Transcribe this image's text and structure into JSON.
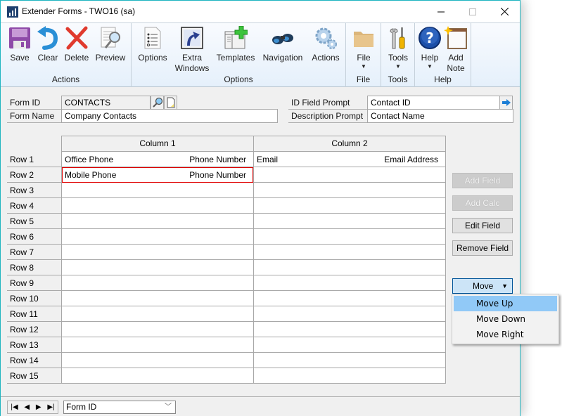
{
  "window": {
    "title": "Extender Forms  -  TWO16 (sa)",
    "controls": {
      "minimize": "—",
      "maximize": "☐",
      "close": "✕"
    }
  },
  "ribbon": {
    "groups": [
      {
        "label": "Actions",
        "buttons": [
          {
            "label": "Save",
            "icon": "save-icon"
          },
          {
            "label": "Clear",
            "icon": "undo-icon"
          },
          {
            "label": "Delete",
            "icon": "delete-x-icon"
          },
          {
            "label": "Preview",
            "icon": "preview-magnifier-icon"
          }
        ]
      },
      {
        "label": "Options",
        "buttons": [
          {
            "label": "Options",
            "icon": "options-list-icon"
          },
          {
            "label": "Extra\nWindows",
            "line1": "Extra",
            "line2": "Windows",
            "icon": "extra-windows-arrow-icon"
          },
          {
            "label": "Templates",
            "icon": "templates-plus-icon"
          },
          {
            "label": "Navigation",
            "icon": "binoculars-icon"
          },
          {
            "label": "Actions",
            "icon": "gears-icon"
          }
        ]
      },
      {
        "label": "File",
        "buttons": [
          {
            "label": "File",
            "icon": "folder-icon",
            "dropdown": true
          }
        ]
      },
      {
        "label": "Tools",
        "buttons": [
          {
            "label": "Tools",
            "icon": "wrench-screwdriver-icon",
            "dropdown": true
          }
        ]
      },
      {
        "label": "Help",
        "buttons": [
          {
            "label": "Help",
            "icon": "help-question-icon",
            "dropdown": true
          },
          {
            "label": "Add\nNote",
            "line1": "Add",
            "line2": "Note",
            "icon": "add-note-icon"
          }
        ]
      }
    ]
  },
  "header": {
    "form_id_label": "Form ID",
    "form_id_value": "CONTACTS",
    "form_name_label": "Form Name",
    "form_name_value": "Company Contacts",
    "id_field_prompt_label": "ID Field Prompt",
    "id_field_prompt_value": "Contact ID",
    "description_prompt_label": "Description Prompt",
    "description_prompt_value": "Contact Name"
  },
  "grid": {
    "columns": [
      "Column 1",
      "Column 2"
    ],
    "rows": [
      {
        "label": "Row 1",
        "cells": [
          {
            "name": "Office Phone",
            "type": "Phone Number"
          },
          {
            "name": "Email",
            "type": "Email Address"
          }
        ]
      },
      {
        "label": "Row 2",
        "cells": [
          {
            "name": "Mobile Phone",
            "type": "Phone Number",
            "selected": true
          },
          {
            "name": "",
            "type": ""
          }
        ]
      },
      {
        "label": "Row 3",
        "cells": [
          {},
          {}
        ]
      },
      {
        "label": "Row 4",
        "cells": [
          {},
          {}
        ]
      },
      {
        "label": "Row 5",
        "cells": [
          {},
          {}
        ]
      },
      {
        "label": "Row 6",
        "cells": [
          {},
          {}
        ]
      },
      {
        "label": "Row 7",
        "cells": [
          {},
          {}
        ]
      },
      {
        "label": "Row 8",
        "cells": [
          {},
          {}
        ]
      },
      {
        "label": "Row 9",
        "cells": [
          {},
          {}
        ]
      },
      {
        "label": "Row 10",
        "cells": [
          {},
          {}
        ]
      },
      {
        "label": "Row 11",
        "cells": [
          {},
          {}
        ]
      },
      {
        "label": "Row 12",
        "cells": [
          {},
          {}
        ]
      },
      {
        "label": "Row 13",
        "cells": [
          {},
          {}
        ]
      },
      {
        "label": "Row 14",
        "cells": [
          {},
          {}
        ]
      },
      {
        "label": "Row 15",
        "cells": [
          {},
          {}
        ]
      }
    ]
  },
  "side_buttons": {
    "add_field": "Add Field",
    "add_calc": "Add Calc",
    "edit_field": "Edit Field",
    "remove_field": "Remove Field",
    "move": "Move"
  },
  "move_menu": {
    "items": [
      "Move Up",
      "Move Down",
      "Move Right"
    ],
    "highlighted": "Move Up"
  },
  "bottom": {
    "nav": {
      "first": "|◀",
      "prev": "◀",
      "next": "▶",
      "last": "▶|"
    },
    "sort_by": "Form ID"
  },
  "colors": {
    "window_border": "#1fb5c0",
    "selection_outline": "#e00000",
    "menu_highlight": "#91c9f7",
    "move_button_bg": "#cce4f7"
  }
}
